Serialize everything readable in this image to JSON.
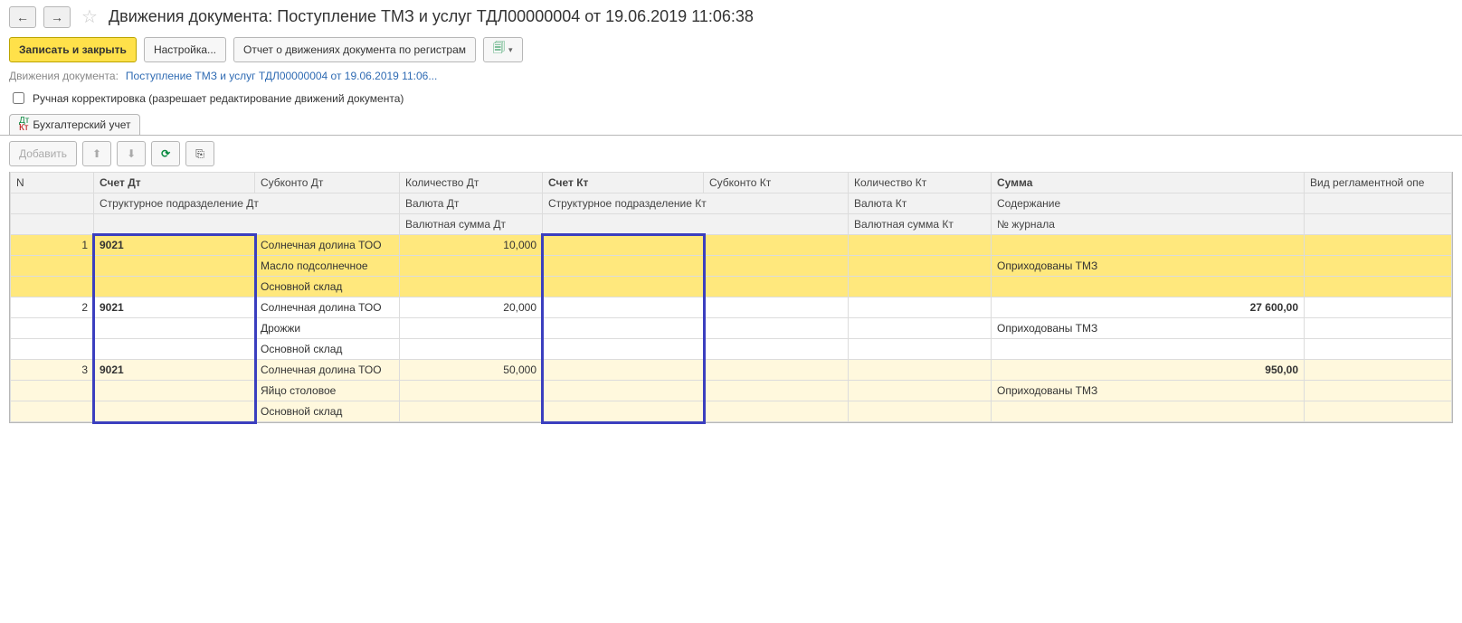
{
  "title": "Движения документа: Поступление ТМЗ и услуг ТДЛ00000004 от 19.06.2019 11:06:38",
  "toolbar": {
    "save_close": "Записать и закрыть",
    "settings": "Настройка...",
    "report": "Отчет о движениях документа по регистрам"
  },
  "breadcrumb": {
    "label": "Движения документа:",
    "link": "Поступление ТМЗ и услуг ТДЛ00000004 от 19.06.2019 11:06..."
  },
  "manual_cb": "Ручная корректировка (разрешает редактирование движений документа)",
  "tab": "Бухгалтерский учет",
  "subtoolbar": {
    "add": "Добавить"
  },
  "headers": {
    "r1": {
      "n": "N",
      "acc_dt": "Счет Дт",
      "sub_dt": "Субконто Дт",
      "qty_dt": "Количество Дт",
      "acc_kt": "Счет Кт",
      "sub_kt": "Субконто Кт",
      "qty_kt": "Количество Кт",
      "sum": "Сумма",
      "regop": "Вид регламентной опе"
    },
    "r2": {
      "struct_dt": "Структурное подразделение Дт",
      "val_dt": "Валюта Дт",
      "struct_kt": "Структурное подразделение Кт",
      "val_kt": "Валюта Кт",
      "content": "Содержание"
    },
    "r3": {
      "valsum_dt": "Валютная сумма Дт",
      "valsum_kt": "Валютная сумма Кт",
      "journal": "№ журнала"
    }
  },
  "rows": [
    {
      "n": "1",
      "acc_dt": "9021",
      "sub1": "Солнечная долина ТОО",
      "sub2": "Масло подсолнечное",
      "sub3": "Основной склад",
      "qty_dt": "10,000",
      "sum": "",
      "content": "Оприходованы ТМЗ"
    },
    {
      "n": "2",
      "acc_dt": "9021",
      "sub1": "Солнечная долина ТОО",
      "sub2": "Дрожжи",
      "sub3": "Основной склад",
      "qty_dt": "20,000",
      "sum": "27 600,00",
      "content": "Оприходованы ТМЗ"
    },
    {
      "n": "3",
      "acc_dt": "9021",
      "sub1": "Солнечная долина ТОО",
      "sub2": "Яйцо столовое",
      "sub3": "Основной склад",
      "qty_dt": "50,000",
      "sum": "950,00",
      "content": "Оприходованы ТМЗ"
    }
  ]
}
